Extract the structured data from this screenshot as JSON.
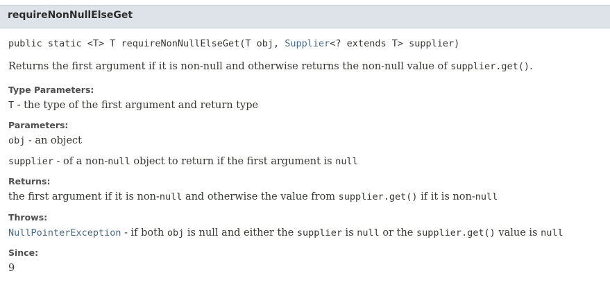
{
  "method": {
    "name": "requireNonNullElseGet",
    "signature": {
      "prefix": "public static <T> T requireNonNullElseGet(T obj, ",
      "type_link": "Supplier",
      "suffix": "<? extends T> supplier)"
    },
    "description": {
      "text": "Returns the first argument if it is non-null and otherwise returns the non-null value of ",
      "code": "supplier.get()",
      "end": "."
    }
  },
  "type_parameters": {
    "label": "Type Parameters:",
    "items": [
      {
        "name": "T",
        "sep": " - ",
        "desc": "the type of the first argument and return type"
      }
    ]
  },
  "parameters": {
    "label": "Parameters:",
    "items": [
      {
        "name": "obj",
        "sep": " - ",
        "desc": "an object"
      },
      {
        "name": "supplier",
        "sep": " - ",
        "desc_a": "of a non-",
        "code_a": "null",
        "desc_b": " object to return if the first argument is ",
        "code_b": "null"
      }
    ]
  },
  "returns": {
    "label": "Returns:",
    "text_a": "the first argument if it is non-",
    "code_a": "null",
    "text_b": " and otherwise the value from ",
    "code_b": "supplier.get()",
    "text_c": " if it is non-",
    "code_c": "null"
  },
  "throws": {
    "label": "Throws:",
    "exception": "NullPointerException",
    "sep": " - ",
    "text_a": "if both ",
    "code_a": "obj",
    "text_b": " is null and either the ",
    "code_b": "supplier",
    "text_c": " is ",
    "code_c": "null",
    "text_d": " or the ",
    "code_d": "supplier.get()",
    "text_e": " value is ",
    "code_e": "null"
  },
  "since": {
    "label": "Since:",
    "value": "9"
  }
}
